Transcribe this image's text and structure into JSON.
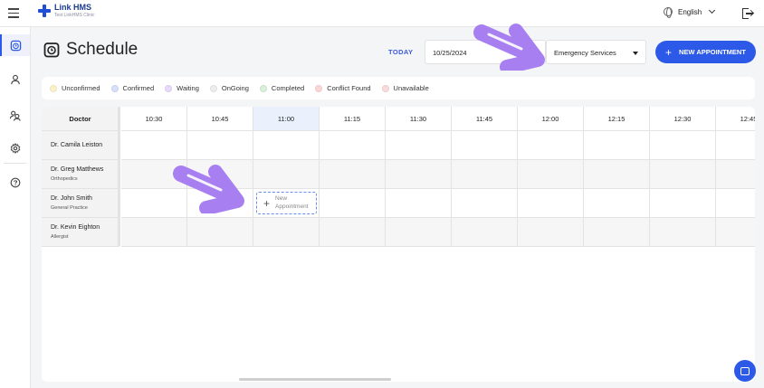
{
  "header": {
    "brand_title": "Link HMS",
    "brand_subtitle": "Test LinkHMS Clinic",
    "language": "English"
  },
  "sidebar": {
    "items": [
      {
        "name": "schedule",
        "icon": "alarm-clock-icon",
        "active": true
      },
      {
        "name": "patients",
        "icon": "person-icon",
        "active": false
      },
      {
        "name": "groups",
        "icon": "group-icon",
        "active": false
      },
      {
        "name": "settings",
        "icon": "gear-icon",
        "active": false
      },
      {
        "name": "help",
        "icon": "help-icon",
        "active": false
      }
    ]
  },
  "page": {
    "title": "Schedule",
    "today_label": "TODAY",
    "date_value": "10/25/2024",
    "service_value": "Emergency Services",
    "new_appointment_label": "NEW APPOINTMENT"
  },
  "legend": [
    {
      "label": "Unconfirmed",
      "color": "#fbf1c9"
    },
    {
      "label": "Confirmed",
      "color": "#d6e0fb"
    },
    {
      "label": "Waiting",
      "color": "#e8d8fb"
    },
    {
      "label": "OnGoing",
      "color": "#ededed"
    },
    {
      "label": "Completed",
      "color": "#d7f0d8"
    },
    {
      "label": "Conflict Found",
      "color": "#fbd6d6"
    },
    {
      "label": "Unavailable",
      "color": "#fadada"
    }
  ],
  "schedule": {
    "doctor_header": "Doctor",
    "times": [
      "10:30",
      "10:45",
      "11:00",
      "11:15",
      "11:30",
      "11:45",
      "12:00",
      "12:15",
      "12:30",
      "12:45"
    ],
    "highlighted_time": "11:00",
    "doctors": [
      {
        "name": "Dr. Camila Leiston",
        "specialty": ""
      },
      {
        "name": "Dr. Greg Matthews",
        "specialty": "Orthopedics"
      },
      {
        "name": "Dr. John Smith",
        "specialty": "General Practice"
      },
      {
        "name": "Dr. Kevin Eighton",
        "specialty": "Allergist"
      }
    ],
    "new_slot_label_1": "New",
    "new_slot_label_2": "Appointment"
  },
  "colors": {
    "accent": "#2c59e8",
    "annotation_arrow": "#a77ff0"
  }
}
